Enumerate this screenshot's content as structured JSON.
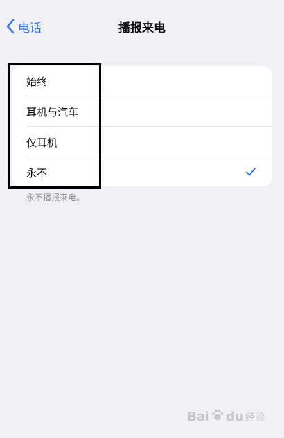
{
  "nav": {
    "back_label": "电话",
    "title": "播报来电"
  },
  "options": [
    {
      "label": "始终",
      "selected": false
    },
    {
      "label": "耳机与汽车",
      "selected": false
    },
    {
      "label": "仅耳机",
      "selected": false
    },
    {
      "label": "永不",
      "selected": true
    }
  ],
  "footer_note": "永不播报来电。",
  "watermark": {
    "left": "Bai",
    "right": "du",
    "suffix": "经验"
  },
  "colors": {
    "accent": "#3478f6",
    "background": "#f1f0f5"
  }
}
